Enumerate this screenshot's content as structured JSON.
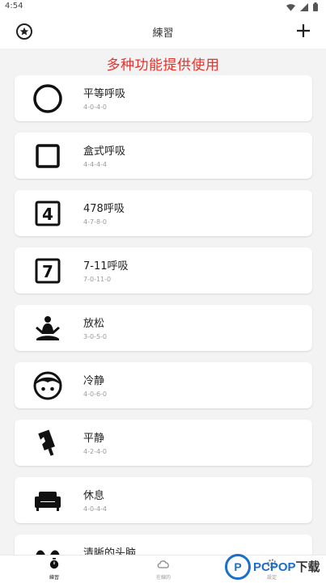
{
  "status_bar": {
    "time": "4:54"
  },
  "app_bar": {
    "title": "練習"
  },
  "banner": "多种功能提供使用",
  "cards": [
    {
      "name": "平等呼吸",
      "pattern": "4-0-4-0",
      "icon": "circle-icon"
    },
    {
      "name": "盒式呼吸",
      "pattern": "4-4-4-4",
      "icon": "square-icon"
    },
    {
      "name": "478呼吸",
      "pattern": "4-7-8-0",
      "icon": "number-four-icon",
      "icon_text": "4"
    },
    {
      "name": "7-11呼吸",
      "pattern": "7-0-11-0",
      "icon": "number-seven-icon",
      "icon_text": "7"
    },
    {
      "name": "放松",
      "pattern": "3-0-5-0",
      "icon": "meditation-icon"
    },
    {
      "name": "冷静",
      "pattern": "4-0-6-0",
      "icon": "face-icon"
    },
    {
      "name": "平静",
      "pattern": "4-2-4-0",
      "icon": "popsicle-icon"
    },
    {
      "name": "休息",
      "pattern": "4-0-4-4",
      "icon": "sofa-icon"
    },
    {
      "name": "清晰的头脑",
      "pattern": "",
      "icon": "lungs-icon"
    }
  ],
  "bottom_nav": [
    {
      "label": "練習",
      "icon": "timer-icon",
      "active": true
    },
    {
      "label": "在線的",
      "icon": "cloud-icon",
      "active": false
    },
    {
      "label": "設定",
      "icon": "settings-icon",
      "active": false
    }
  ],
  "watermark": {
    "letter": "P",
    "brand": "PCPOP",
    "suffix": "下载"
  },
  "colors": {
    "banner": "#e8322b",
    "watermark": "#1a6fc9"
  }
}
